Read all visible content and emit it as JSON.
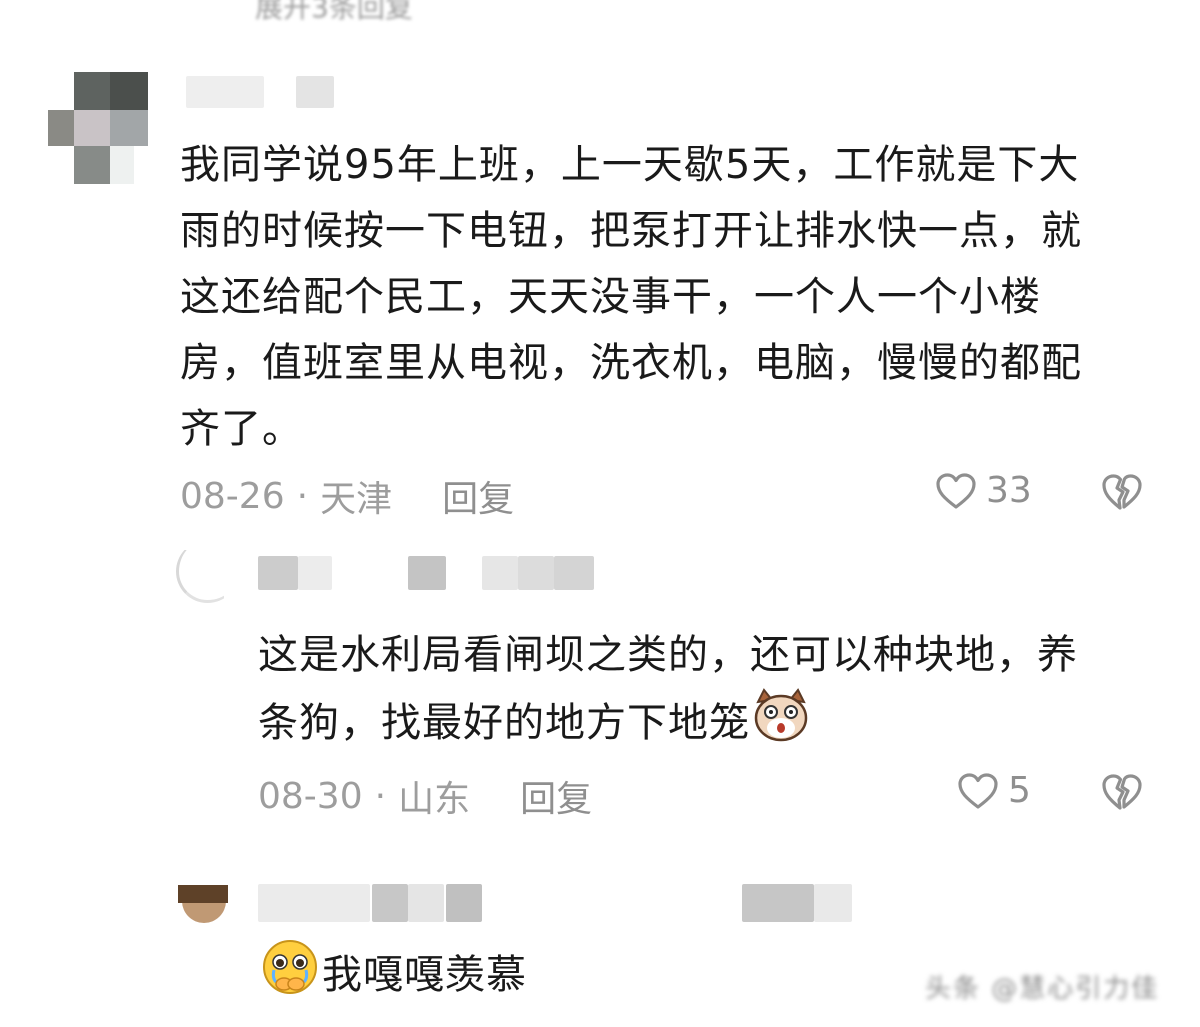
{
  "top_partial_text": "展开3条回复",
  "comments": [
    {
      "text_lines": [
        "我同学说95年上班，上一天歇5天，工作就是下大",
        "雨的时候按一下电钮，把泵打开让排水快一点，就",
        "这还给配个民工，天天没事干，一个人一个小楼",
        "房，值班室里从电视，洗衣机，电脑，慢慢的都配",
        "齐了。"
      ],
      "date": "08-26",
      "separator": "·",
      "location": "天津",
      "reply_label": "回复",
      "likes": "33"
    },
    {
      "text_lines": [
        "这是水利局看闸坝之类的，还可以种块地，养",
        "条狗，找最好的地方下地笼"
      ],
      "date": "08-30",
      "separator": "·",
      "location": "山东",
      "reply_label": "回复",
      "likes": "5"
    },
    {
      "text": "我嘎嘎羡慕"
    }
  ],
  "watermark": "头条 @慧心引力佳",
  "colors": {
    "text": "#1a1a1a",
    "meta": "#9d9d9d",
    "background": "#ffffff"
  },
  "icons": [
    "heart-outline-icon",
    "broken-heart-icon",
    "dog-emoji-icon",
    "crying-emoji-icon"
  ]
}
